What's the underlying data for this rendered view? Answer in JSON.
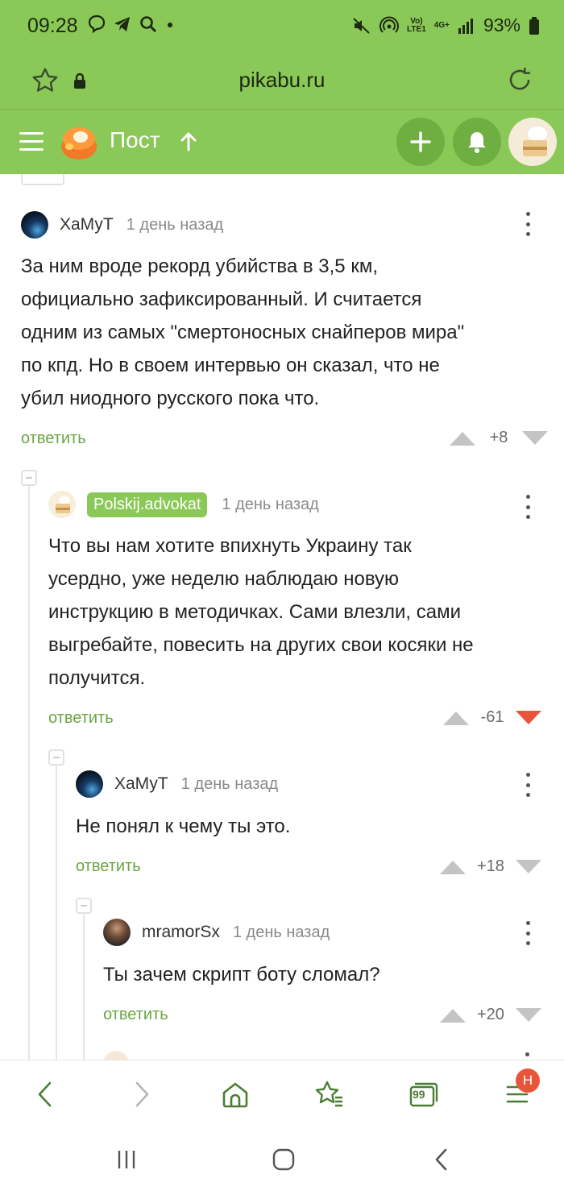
{
  "status_bar": {
    "time": "09:28",
    "battery": "93%",
    "net_top": "Vo)",
    "net_bottom": "LTE1",
    "net_gen": "4G+",
    "left_icons": [
      "viber-icon",
      "telegram-icon",
      "search-icon",
      "dot-icon"
    ],
    "right_icons": [
      "mute-icon",
      "hotspot-icon",
      "signal-icon",
      "battery-icon"
    ]
  },
  "browser": {
    "url": "pikabu.ru"
  },
  "site_header": {
    "title": "Пост",
    "accent": "#8ac858"
  },
  "comments": [
    {
      "author": "ХаМуТ",
      "time": "1 день назад",
      "text_lines": [
        "За ним вроде рекорд убийства в 3,5 км,",
        "официально зафиксированный. И считается",
        "одним из самых \"смертоносных снайперов мира\"",
        "по кпд. Но в своем интервью он сказал, что не",
        "убил ниодного русского пока что."
      ],
      "reply_label": "ответить",
      "score": "+8"
    },
    {
      "author": "Polskij.advokat",
      "time": "1 день назад",
      "text_lines": [
        "Что вы нам хотите впихнуть Украину так",
        "усердно, уже неделю наблюдаю новую",
        "инструкцию в методичках. Сами влезли, сами",
        "выгребайте, повесить на других свои косяки не",
        "получится."
      ],
      "reply_label": "ответить",
      "score": "-61",
      "downvoted_color": "#e8553a"
    },
    {
      "author": "ХаМуТ",
      "time": "1 день назад",
      "text_lines": [
        "Не понял к чему ты это."
      ],
      "reply_label": "ответить",
      "score": "+18"
    },
    {
      "author": "mramorSx",
      "time": "1 день назад",
      "text_lines": [
        "Ты зачем скрипт боту сломал?"
      ],
      "reply_label": "ответить",
      "score": "+20"
    }
  ],
  "bottom_nav": {
    "items": [
      "back-icon",
      "forward-icon",
      "home-icon",
      "bookmarks-icon",
      "tabs-icon",
      "menu-icon"
    ],
    "tabs_count": "99",
    "menu_badge": "Н"
  }
}
